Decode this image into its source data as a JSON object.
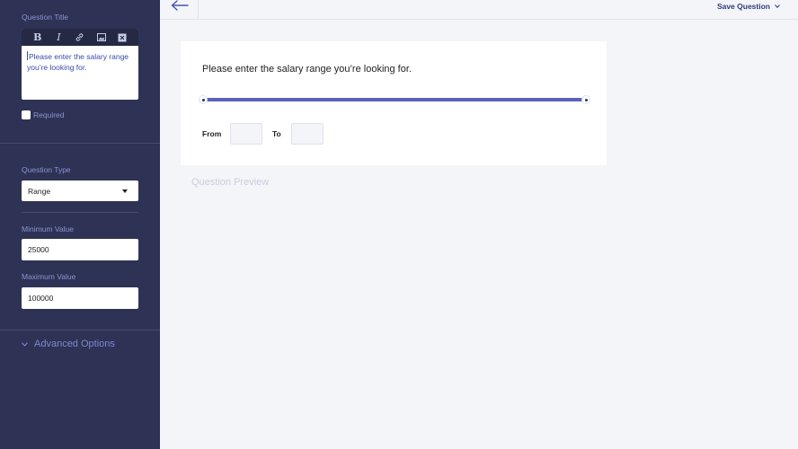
{
  "sidebar": {
    "question_title_label": "Question Title",
    "toolbar_icons": [
      "bold-icon",
      "italic-icon",
      "link-icon",
      "image-icon",
      "clear-format-icon"
    ],
    "question_title_text": "Please enter the salary range you’re looking for.",
    "required_label": "Required",
    "required_checked": false,
    "question_type_label": "Question Type",
    "question_type_value": "Range",
    "min_label": "Minimum Value",
    "min_value": "25000",
    "max_label": "Maximum Value",
    "max_value": "100000",
    "advanced_label": "Advanced Options"
  },
  "header": {
    "save_label": "Save Question"
  },
  "preview_card": {
    "question_text": "Please enter the salary range you’re looking for.",
    "from_label": "From",
    "to_label": "To"
  },
  "preview_caption": "Question Preview",
  "colors": {
    "sidebar_bg": "#2e3254",
    "accent": "#5a62bc",
    "label": "#8a94d4"
  }
}
